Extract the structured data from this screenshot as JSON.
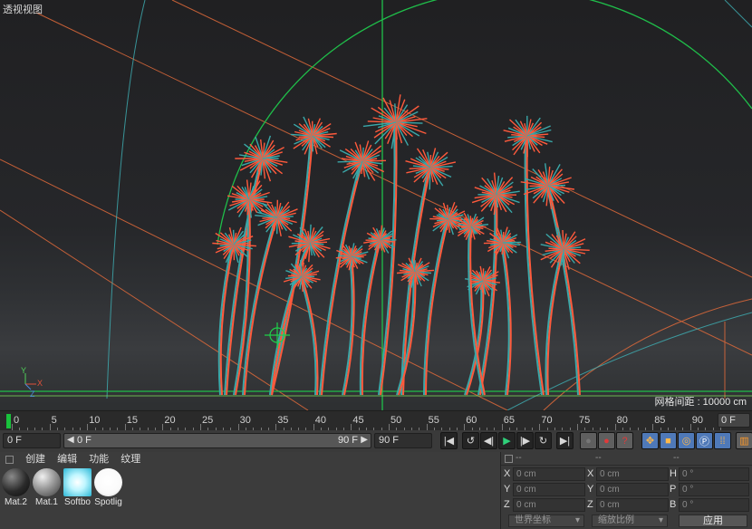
{
  "viewport": {
    "title": "透视视图",
    "grid_spacing": "网格间距 : 10000 cm",
    "axis_labels": {
      "y": "Y",
      "x": "X",
      "z": "Z"
    }
  },
  "timeline": {
    "ticks": [
      "0",
      "5",
      "10",
      "15",
      "20",
      "25",
      "30",
      "35",
      "40",
      "45",
      "50",
      "55",
      "60",
      "65",
      "70",
      "75",
      "80",
      "85",
      "90"
    ],
    "current_frame_field": "0 F",
    "playhead_color": "#19c23c"
  },
  "transport": {
    "start_field": "0 F",
    "range_start": "0 F",
    "range_end": "90 F",
    "end_field": "90 F"
  },
  "materials_panel": {
    "menu": [
      "创建",
      "编辑",
      "功能",
      "纹理"
    ],
    "materials": [
      {
        "name": "Mat.2",
        "style": "dark"
      },
      {
        "name": "Mat.1",
        "style": "grey"
      },
      {
        "name": "Softbo",
        "style": "cyan"
      },
      {
        "name": "Spotlig",
        "style": "white"
      }
    ]
  },
  "coordinates": {
    "headers": [
      "--",
      "--",
      "--"
    ],
    "rows": [
      {
        "a": "X",
        "a_val": "0 cm",
        "b": "X",
        "b_val": "0 cm",
        "c": "H",
        "c_val": "0 °"
      },
      {
        "a": "Y",
        "a_val": "0 cm",
        "b": "Y",
        "b_val": "0 cm",
        "c": "P",
        "c_val": "0 °"
      },
      {
        "a": "Z",
        "a_val": "0 cm",
        "b": "Z",
        "b_val": "0 cm",
        "c": "B",
        "c_val": "0 °"
      }
    ],
    "world_coords_option": "世界坐标",
    "scale_option": "缩放比例",
    "apply_label": "应用"
  },
  "colors": {
    "accent_orange": "#ff5a3c",
    "accent_teal": "#3aa7a8",
    "guide_green": "#1fbf4a",
    "select_blue": "#4f79b8"
  }
}
